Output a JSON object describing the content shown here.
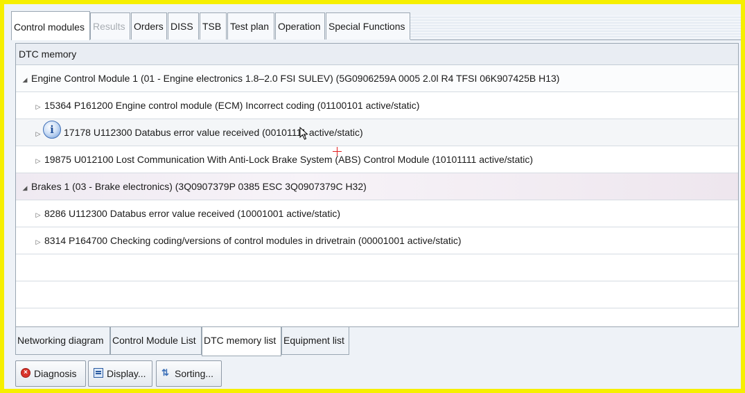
{
  "tabs": [
    {
      "label": "Control modules",
      "state": "active"
    },
    {
      "label": "Results",
      "state": "disabled"
    },
    {
      "label": "Orders",
      "state": "normal"
    },
    {
      "label": "DISS",
      "state": "normal"
    },
    {
      "label": "TSB",
      "state": "normal"
    },
    {
      "label": "Test plan",
      "state": "normal"
    },
    {
      "label": "Operation",
      "state": "normal"
    },
    {
      "label": "Special Functions",
      "state": "normal"
    }
  ],
  "panel": {
    "title": "DTC memory",
    "rows": [
      {
        "kind": "group",
        "expanded": true,
        "text": "Engine Control Module 1 (01 - Engine electronics 1.8–2.0 FSI SULEV) (5G0906259A   0005  2.0l R4 TFSI    06K907425B    H13)"
      },
      {
        "kind": "child",
        "expanded": false,
        "text": "15364   P161200   Engine control module (ECM) Incorrect coding  (01100101   active/static)"
      },
      {
        "kind": "child",
        "expanded": false,
        "info": true,
        "text": "17178   U112300   Databus error value received  (00101111   active/static)"
      },
      {
        "kind": "child",
        "expanded": false,
        "text": "19875   U012100   Lost Communication With Anti-Lock Brake System (ABS) Control Module  (10101111   active/static)"
      },
      {
        "kind": "group",
        "expanded": true,
        "highlight": true,
        "text": "Brakes 1 (03 - Brake electronics) (3Q0907379P    0385   ESC           3Q0907379C    H32)"
      },
      {
        "kind": "child",
        "expanded": false,
        "text": "8286   U112300   Databus error value received  (10001001   active/static)"
      },
      {
        "kind": "child",
        "expanded": false,
        "text": "8314   P164700   Checking coding/versions of control modules in drivetrain  (00001001   active/static)"
      }
    ]
  },
  "bottom_tabs": [
    {
      "label": "Networking diagram",
      "state": "normal"
    },
    {
      "label": "Control Module List",
      "state": "normal"
    },
    {
      "label": "DTC memory list",
      "state": "active"
    },
    {
      "label": "Equipment list",
      "state": "normal"
    }
  ],
  "buttons": {
    "diagnosis": "Diagnosis",
    "display": "Display...",
    "sorting": "Sorting..."
  },
  "icons": {
    "info": "i",
    "diagnosis": "stop-circle-icon",
    "display": "display-icon",
    "sorting": "sort-icon"
  },
  "colors": {
    "frame": "#f6ef00",
    "annotation_cross": "#e02020"
  }
}
